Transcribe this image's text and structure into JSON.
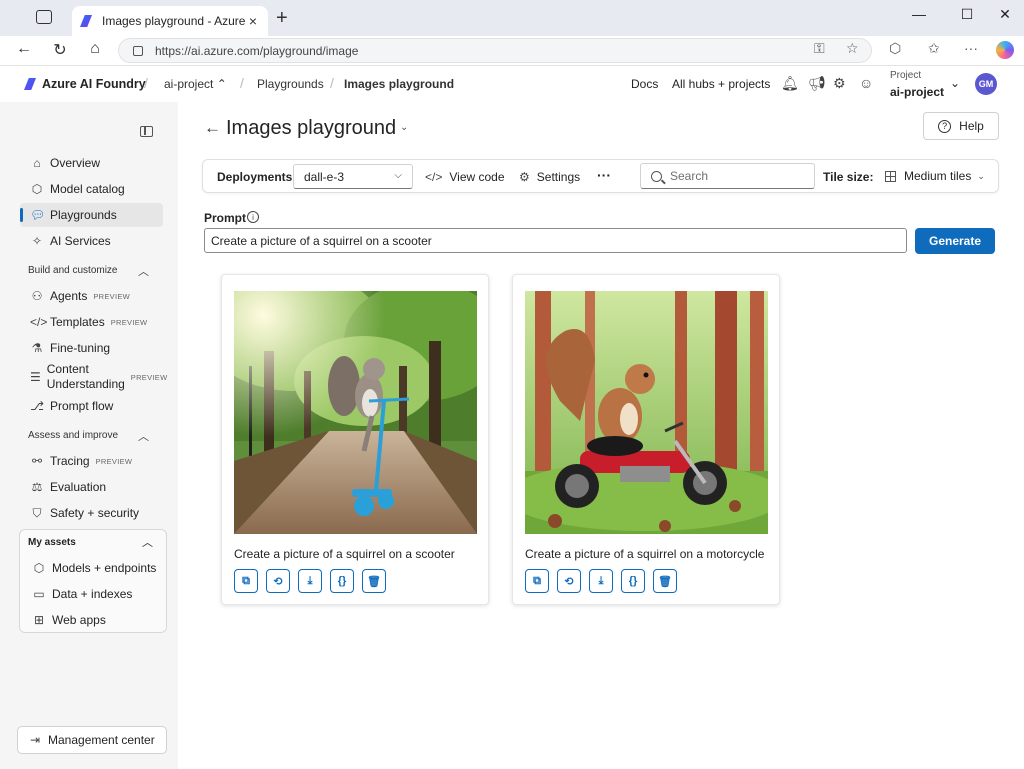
{
  "browser": {
    "tab_title": "Images playground - Azure AI Foundry",
    "url": "https://ai.azure.com/playground/image"
  },
  "header": {
    "brand": "Azure AI Foundry",
    "project_crumb": "ai-project",
    "crumb_playgrounds": "Playgrounds",
    "crumb_current": "Images playground",
    "docs": "Docs",
    "hubs": "All hubs + projects",
    "project_label": "Project",
    "project_name": "ai-project",
    "avatar": "GM"
  },
  "sidebar": {
    "items": [
      {
        "label": "Overview"
      },
      {
        "label": "Model catalog"
      },
      {
        "label": "Playgrounds"
      },
      {
        "label": "AI Services"
      }
    ],
    "section_build": "Build and customize",
    "build_items": [
      {
        "label": "Agents",
        "badge": "PREVIEW"
      },
      {
        "label": "Templates",
        "badge": "PREVIEW"
      },
      {
        "label": "Fine-tuning"
      },
      {
        "label": "Content Understanding",
        "badge": "PREVIEW"
      },
      {
        "label": "Prompt flow"
      }
    ],
    "section_assess": "Assess and improve",
    "assess_items": [
      {
        "label": "Tracing",
        "badge": "PREVIEW"
      },
      {
        "label": "Evaluation"
      },
      {
        "label": "Safety + security"
      }
    ],
    "section_assets": "My assets",
    "asset_items": [
      {
        "label": "Models + endpoints"
      },
      {
        "label": "Data + indexes"
      },
      {
        "label": "Web apps"
      }
    ],
    "management": "Management center"
  },
  "main": {
    "title": "Images playground",
    "help": "Help",
    "toolbar": {
      "deployments_label": "Deployments",
      "deployment_value": "dall-e-3",
      "view_code": "View code",
      "settings": "Settings",
      "more": "···",
      "search_placeholder": "Search",
      "tile_size_label": "Tile size:",
      "tile_size_value": "Medium tiles"
    },
    "prompt_label": "Prompt",
    "prompt_value": "Create a picture of a squirrel on a scooter",
    "generate": "Generate",
    "cards": [
      {
        "caption": "Create a picture of a squirrel on a scooter"
      },
      {
        "caption": "Create a picture of a squirrel on a motorcycle"
      }
    ]
  },
  "colors": {
    "accent": "#0f6cbd",
    "sidebar_bg": "#f5f5f5"
  }
}
